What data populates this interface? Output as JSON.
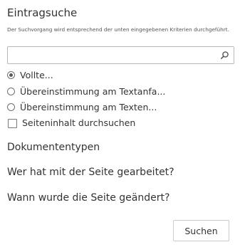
{
  "panel": {
    "title": "Eintragsuche",
    "description": "Der Suchvorgang wird entsprechend der unten eingegebenen Kriterien durchgeführt."
  },
  "search": {
    "value": "",
    "placeholder": "",
    "icon": "search-icon"
  },
  "match_options": [
    {
      "label": "Vollte...",
      "selected": true
    },
    {
      "label": "Übereinstimmung am Textanfa...",
      "selected": false
    },
    {
      "label": "Übereinstimmung am Texten...",
      "selected": false
    }
  ],
  "page_content_checkbox": {
    "label": "Seiteninhalt durchsuchen",
    "checked": false
  },
  "sections": {
    "document_types": "Dokumententypen",
    "who_worked": "Wer hat mit der Seite gearbeitet?",
    "when_changed": "Wann wurde die Seite geändert?"
  },
  "submit_label": "Suchen"
}
